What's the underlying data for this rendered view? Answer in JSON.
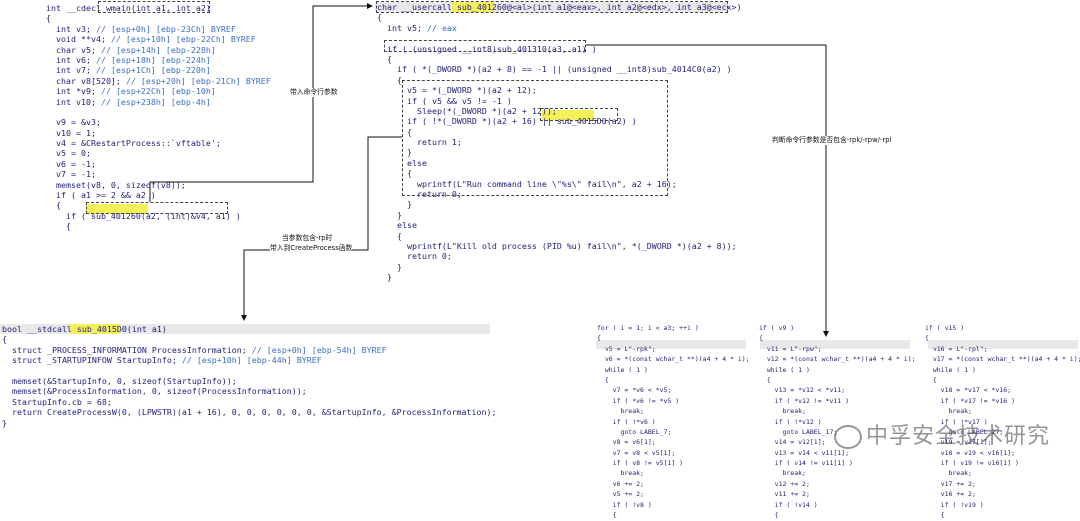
{
  "main_block": [
    "int __cdecl wmain(int a1, int a2)",
    "{",
    "  int v3; // [esp+0h] [ebp-23Ch] BYREF",
    "  void **v4; // [esp+10h] [ebp-22Ch] BYREF",
    "  char v5; // [esp+14h] [ebp-228h]",
    "  int v6; // [esp+18h] [ebp-224h]",
    "  int v7; // [esp+1Ch] [ebp-220h]",
    "  char v8[520]; // [esp+20h] [ebp-21Ch] BYREF",
    "  int *v9; // [esp+22Ch] [ebp-10h]",
    "  int v10; // [esp+238h] [ebp-4h]",
    "",
    "  v9 = &v3;",
    "  v10 = 1;",
    "  v4 = &CRestartProcess::`vftable';",
    "  v5 = 0;",
    "  v6 = -1;",
    "  v7 = -1;",
    "  memset(v8, 0, sizeof(v8));",
    "  if ( a1 >= 2 && a2 )",
    "  {",
    "    if ( sub_401260(a2, (int)&v4, a1) )",
    "    {"
  ],
  "sub401260_block": [
    "char __usercall sub_401260@<al>(int a1@<eax>, int a2@<edx>, int a3@<ecx>)",
    "{",
    "  int v5; // eax",
    "",
    "  if ( (unsigned __int8)sub_401310(a3, a1) )",
    "  {",
    "    if ( *(_DWORD *)(a2 + 8) == -1 || (unsigned __int8)sub_4014C0(a2) )",
    "    {",
    "      v5 = *(_DWORD *)(a2 + 12);",
    "      if ( v5 && v5 != -1 )",
    "        Sleep(*(_DWORD *)(a2 + 12));",
    "      if ( !*(_DWORD *)(a2 + 16) || sub_4015D0(a2) )",
    "      {",
    "        return 1;",
    "      }",
    "      else",
    "      {",
    "        wprintf(L\"Run command line \\\"%s\\\" fail\\n\", a2 + 16);",
    "        return 0;",
    "      }",
    "    }",
    "    else",
    "    {",
    "      wprintf(L\"Kill old process (PID %u) fail\\n\", *(_DWORD *)(a2 + 8));",
    "      return 0;",
    "    }",
    "  }"
  ],
  "sub4015d0_block": [
    "bool __stdcall sub_4015D0(int a1)",
    "{",
    "  struct _PROCESS_INFORMATION ProcessInformation; // [esp+0h] [ebp-54h] BYREF",
    "  struct _STARTUPINFOW StartupInfo; // [esp+10h] [ebp-44h] BYREF",
    "",
    "  memset(&StartupInfo, 0, sizeof(StartupInfo));",
    "  memset(&ProcessInformation, 0, sizeof(ProcessInformation));",
    "  StartupInfo.cb = 68;",
    "  return CreateProcessW(0, (LPWSTR)(a1 + 16), 0, 0, 0, 0, 0, 0, &StartupInfo, &ProcessInformation);",
    "}"
  ],
  "rpk_block": [
    "for ( i = 1; i < a3; ++i )",
    "{",
    "  v5 = L\"-rpk\";",
    "  v6 = *(const wchar_t **)(a4 + 4 * i);",
    "  while ( 1 )",
    "  {",
    "    v7 = *v6 < *v5;",
    "    if ( *v6 != *v5 )",
    "      break;",
    "    if ( !*v6 )",
    "      goto LABEL_7;",
    "    v8 = v6[1];",
    "    v7 = v8 < v5[1];",
    "    if ( v8 != v5[1] )",
    "      break;",
    "    v6 += 2;",
    "    v5 += 2;",
    "    if ( !v8 )",
    "    {"
  ],
  "rpw_block": [
    "if ( v9 )",
    "{",
    "  v11 = L\"-rpw\";",
    "  v12 = *(const wchar_t **)(a4 + 4 * i);",
    "  while ( 1 )",
    "  {",
    "    v13 = *v12 < *v11;",
    "    if ( *v12 != *v11 )",
    "      break;",
    "    if ( !*v12 )",
    "      goto LABEL_17;",
    "    v14 = v12[1];",
    "    v13 = v14 < v11[1];",
    "    if ( v14 != v11[1] )",
    "      break;",
    "    v12 += 2;",
    "    v11 += 2;",
    "    if ( !v14 )",
    "    {"
  ],
  "rpl_block": [
    "if ( v15 )",
    "{",
    "  v16 = L\"-rpl\";",
    "  v17 = *(const wchar_t **)(a4 + 4 * i);",
    "  while ( 1 )",
    "  {",
    "    v18 = *v17 < *v16;",
    "    if ( *v17 != *v16 )",
    "      break;",
    "    if ( !*v17 )",
    "      goto LABEL_27;",
    "    v19 = v17[1];",
    "    v18 = v19 < v16[1];",
    "    if ( v19 != v16[1] )",
    "      break;",
    "    v17 += 2;",
    "    v16 += 2;",
    "    if ( !v19 )",
    "    {"
  ],
  "annotations": {
    "pass_args": "带入命令行参数",
    "check_args": "判断命令行参数是否包含-rpk/-rpw/-rpl",
    "rp_line1": "当参数包含-rp时",
    "rp_line2": "带入到CreateProcess函数"
  },
  "watermark": "中孚安全技术研究",
  "colors": {
    "highlight": "#f4f05a",
    "comment": "#3b6fc4",
    "keyword": "#0000b0",
    "variable": "#b000b0",
    "header_bg": "#e8e8e8"
  }
}
